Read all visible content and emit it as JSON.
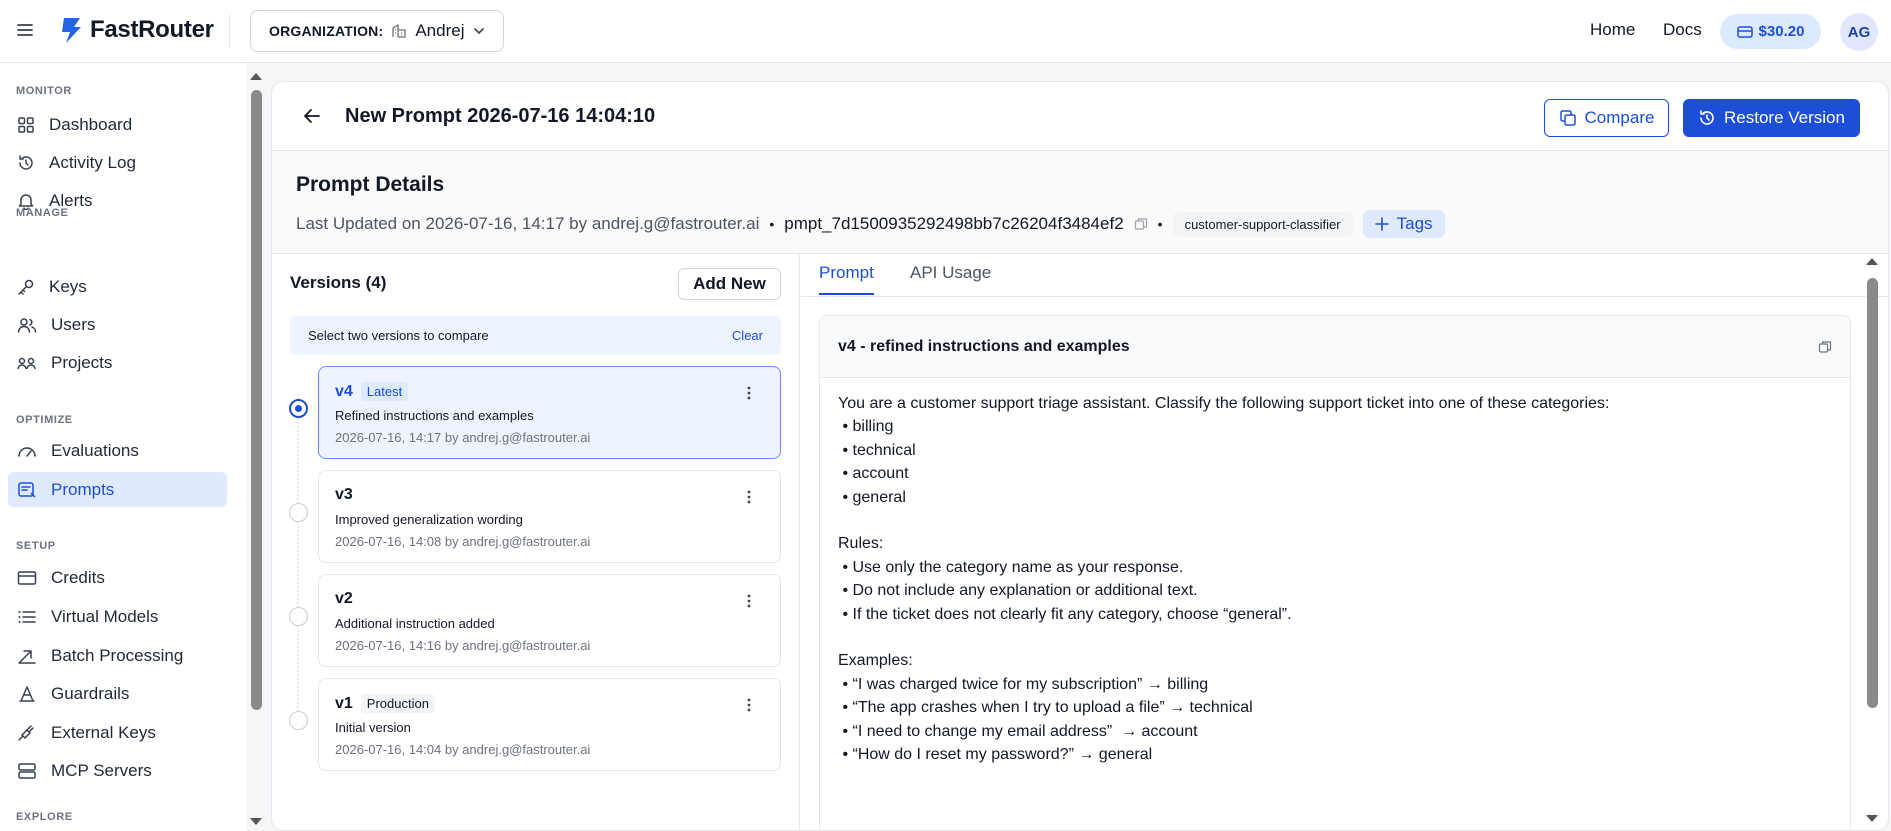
{
  "app": {
    "name": "FastRouter",
    "organization_label": "ORGANIZATION:",
    "organization_name": "Andrej"
  },
  "topnav": {
    "home": "Home",
    "docs": "Docs",
    "credits": "$30.20",
    "avatar": "AG"
  },
  "sidebar": {
    "sections": [
      {
        "title": "MONITOR",
        "items": [
          {
            "label": "Dashboard",
            "icon": "grid-icon"
          },
          {
            "label": "Activity Log",
            "icon": "history-icon"
          },
          {
            "label": "Alerts",
            "icon": "bell-icon"
          }
        ]
      },
      {
        "title": "MANAGE",
        "items": [
          {
            "label": "Keys",
            "icon": "key-icon"
          },
          {
            "label": "Users",
            "icon": "users-icon"
          },
          {
            "label": "Projects",
            "icon": "projects-icon"
          }
        ]
      },
      {
        "title": "OPTIMIZE",
        "items": [
          {
            "label": "Evaluations",
            "icon": "gauge-icon"
          },
          {
            "label": "Prompts",
            "icon": "prompt-icon",
            "active": true
          }
        ]
      },
      {
        "title": "SETUP",
        "items": [
          {
            "label": "Credits",
            "icon": "card-icon"
          },
          {
            "label": "Virtual Models",
            "icon": "list-icon"
          },
          {
            "label": "Batch Processing",
            "icon": "batch-icon"
          },
          {
            "label": "Guardrails",
            "icon": "guard-icon"
          },
          {
            "label": "External Keys",
            "icon": "plug-icon"
          },
          {
            "label": "MCP Servers",
            "icon": "server-icon"
          }
        ]
      },
      {
        "title": "EXPLORE",
        "items": []
      }
    ]
  },
  "page": {
    "title": "New Prompt 2026-07-16 14:04:10",
    "compare_label": "Compare",
    "restore_label": "Restore Version"
  },
  "details": {
    "title": "Prompt Details",
    "updated": "Last Updated on 2026-07-16, 14:17 by andrej.g@fastrouter.ai",
    "prompt_id": "pmpt_7d1500935292498bb7c26204f3484ef2",
    "tag": "customer-support-classifier",
    "tags_button": "Tags"
  },
  "versions": {
    "title": "Versions (4)",
    "add_new": "Add New",
    "compare_hint": "Select two versions to compare",
    "clear": "Clear",
    "items": [
      {
        "name": "v4",
        "badge": "Latest",
        "desc": "Refined instructions and examples",
        "date": "2026-07-16, 14:17 by andrej.g@fastrouter.ai",
        "selected": true
      },
      {
        "name": "v3",
        "badge": "",
        "desc": "Improved generalization wording",
        "date": "2026-07-16, 14:08 by andrej.g@fastrouter.ai",
        "selected": false
      },
      {
        "name": "v2",
        "badge": "",
        "desc": "Additional instruction added",
        "date": "2026-07-16, 14:16 by andrej.g@fastrouter.ai",
        "selected": false
      },
      {
        "name": "v1",
        "badge": "Production",
        "desc": "Initial version",
        "date": "2026-07-16, 14:04 by andrej.g@fastrouter.ai",
        "selected": false
      }
    ]
  },
  "tabs": {
    "prompt": "Prompt",
    "api_usage": "API Usage"
  },
  "prompt": {
    "header": "v4 - refined instructions and examples",
    "body": "You are a customer support triage assistant. Classify the following support ticket into one of these categories:\n • billing\n • technical\n • account\n • general\n\nRules:\n • Use only the category name as your response.\n • Do not include any explanation or additional text.\n • If the ticket does not clearly fit any category, choose “general”.\n\nExamples:\n • “I was charged twice for my subscription” → billing\n • “The app crashes when I try to upload a file” → technical\n • “I need to change my email address”  → account\n • “How do I reset my password?” → general"
  },
  "colors": {
    "accent": "#1d4ed8",
    "active_bg": "#e0eaff"
  }
}
